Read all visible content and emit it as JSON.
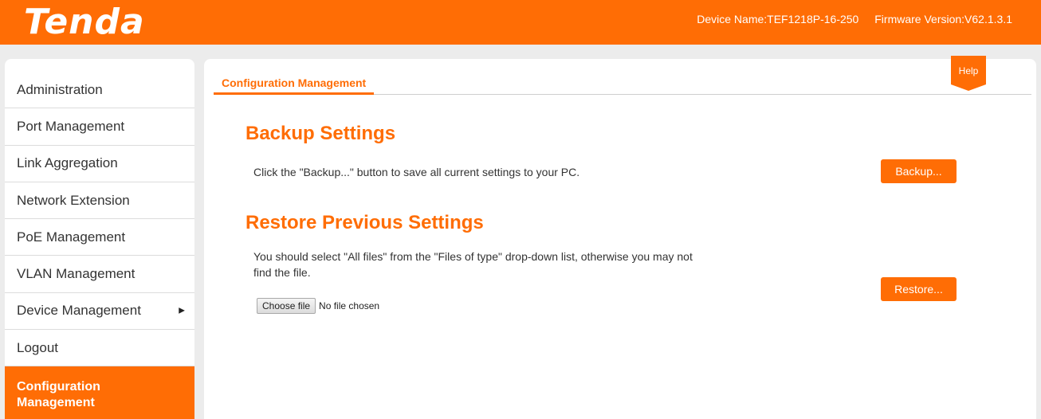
{
  "header": {
    "logo_text": "Tenda",
    "device_name": "Device Name:TEF1218P-16-250",
    "firmware_version": "Firmware Version:V62.1.3.1"
  },
  "sidebar": {
    "items": [
      {
        "label": "Administration"
      },
      {
        "label": "Port Management"
      },
      {
        "label": "Link Aggregation"
      },
      {
        "label": "Network Extension"
      },
      {
        "label": "PoE Management"
      },
      {
        "label": "VLAN Management"
      },
      {
        "label": "Device Management",
        "has_submenu": true
      },
      {
        "label": "Logout"
      },
      {
        "label": "Configuration Management",
        "active": true
      }
    ],
    "submenu_arrow": "▶"
  },
  "main": {
    "tab_label": "Configuration Management",
    "help_label": "Help",
    "backup": {
      "title": "Backup Settings",
      "description": "Click the \"Backup...\" button to save all current settings to your PC.",
      "button_label": "Backup..."
    },
    "restore": {
      "title": "Restore Previous Settings",
      "description_line1": "You should select \"All files\" from the \"Files of type\" drop-down list, otherwise you may not",
      "description_line2": "find the file.",
      "button_label": "Restore...",
      "choose_file_label": "Choose file",
      "file_status": "No file chosen"
    }
  },
  "colors": {
    "brand": "#ff6d05"
  }
}
